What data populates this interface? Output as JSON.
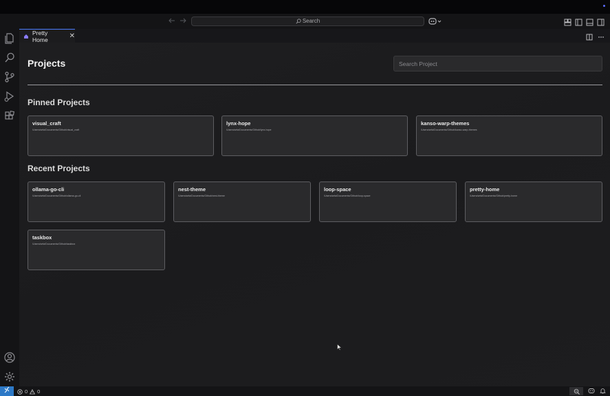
{
  "command_center": {
    "search_label": "Search"
  },
  "tab": {
    "title": "Pretty Home",
    "close": "✕"
  },
  "page": {
    "title": "Projects",
    "search_placeholder": "Search Project"
  },
  "pinned": {
    "title": "Pinned Projects",
    "projects": [
      {
        "name": "visual_craft",
        "path": "/Users/sefa/Documents/Github/visual_craft"
      },
      {
        "name": "lynx-hope",
        "path": "/Users/sefa/Documents/Github/lynx-hope"
      },
      {
        "name": "kanso-warp-themes",
        "path": "/Users/sefa/Documents/Github/kanso-warp-themes"
      }
    ]
  },
  "recent": {
    "title": "Recent Projects",
    "projects": [
      {
        "name": "ollama-go-cli",
        "path": "/Users/sefa/Documents/Github/ollama-go-cli"
      },
      {
        "name": "nest-theme",
        "path": "/Users/sefa/Documents/Github/nest-theme"
      },
      {
        "name": "loop-space",
        "path": "/Users/sefa/Documents/Github/loop-space"
      },
      {
        "name": "pretty-home",
        "path": "/Users/sefa/Documents/Github/pretty-home"
      },
      {
        "name": "taskbox",
        "path": "/Users/sefa/Documents/Github/taskbox"
      }
    ]
  },
  "statusbar": {
    "errors": "0",
    "warnings": "0"
  },
  "colors": {
    "accent": "#4a7cff",
    "remote": "#2d79c7",
    "card_bg": "#2a2a2c",
    "card_border": "#5e5e62"
  }
}
